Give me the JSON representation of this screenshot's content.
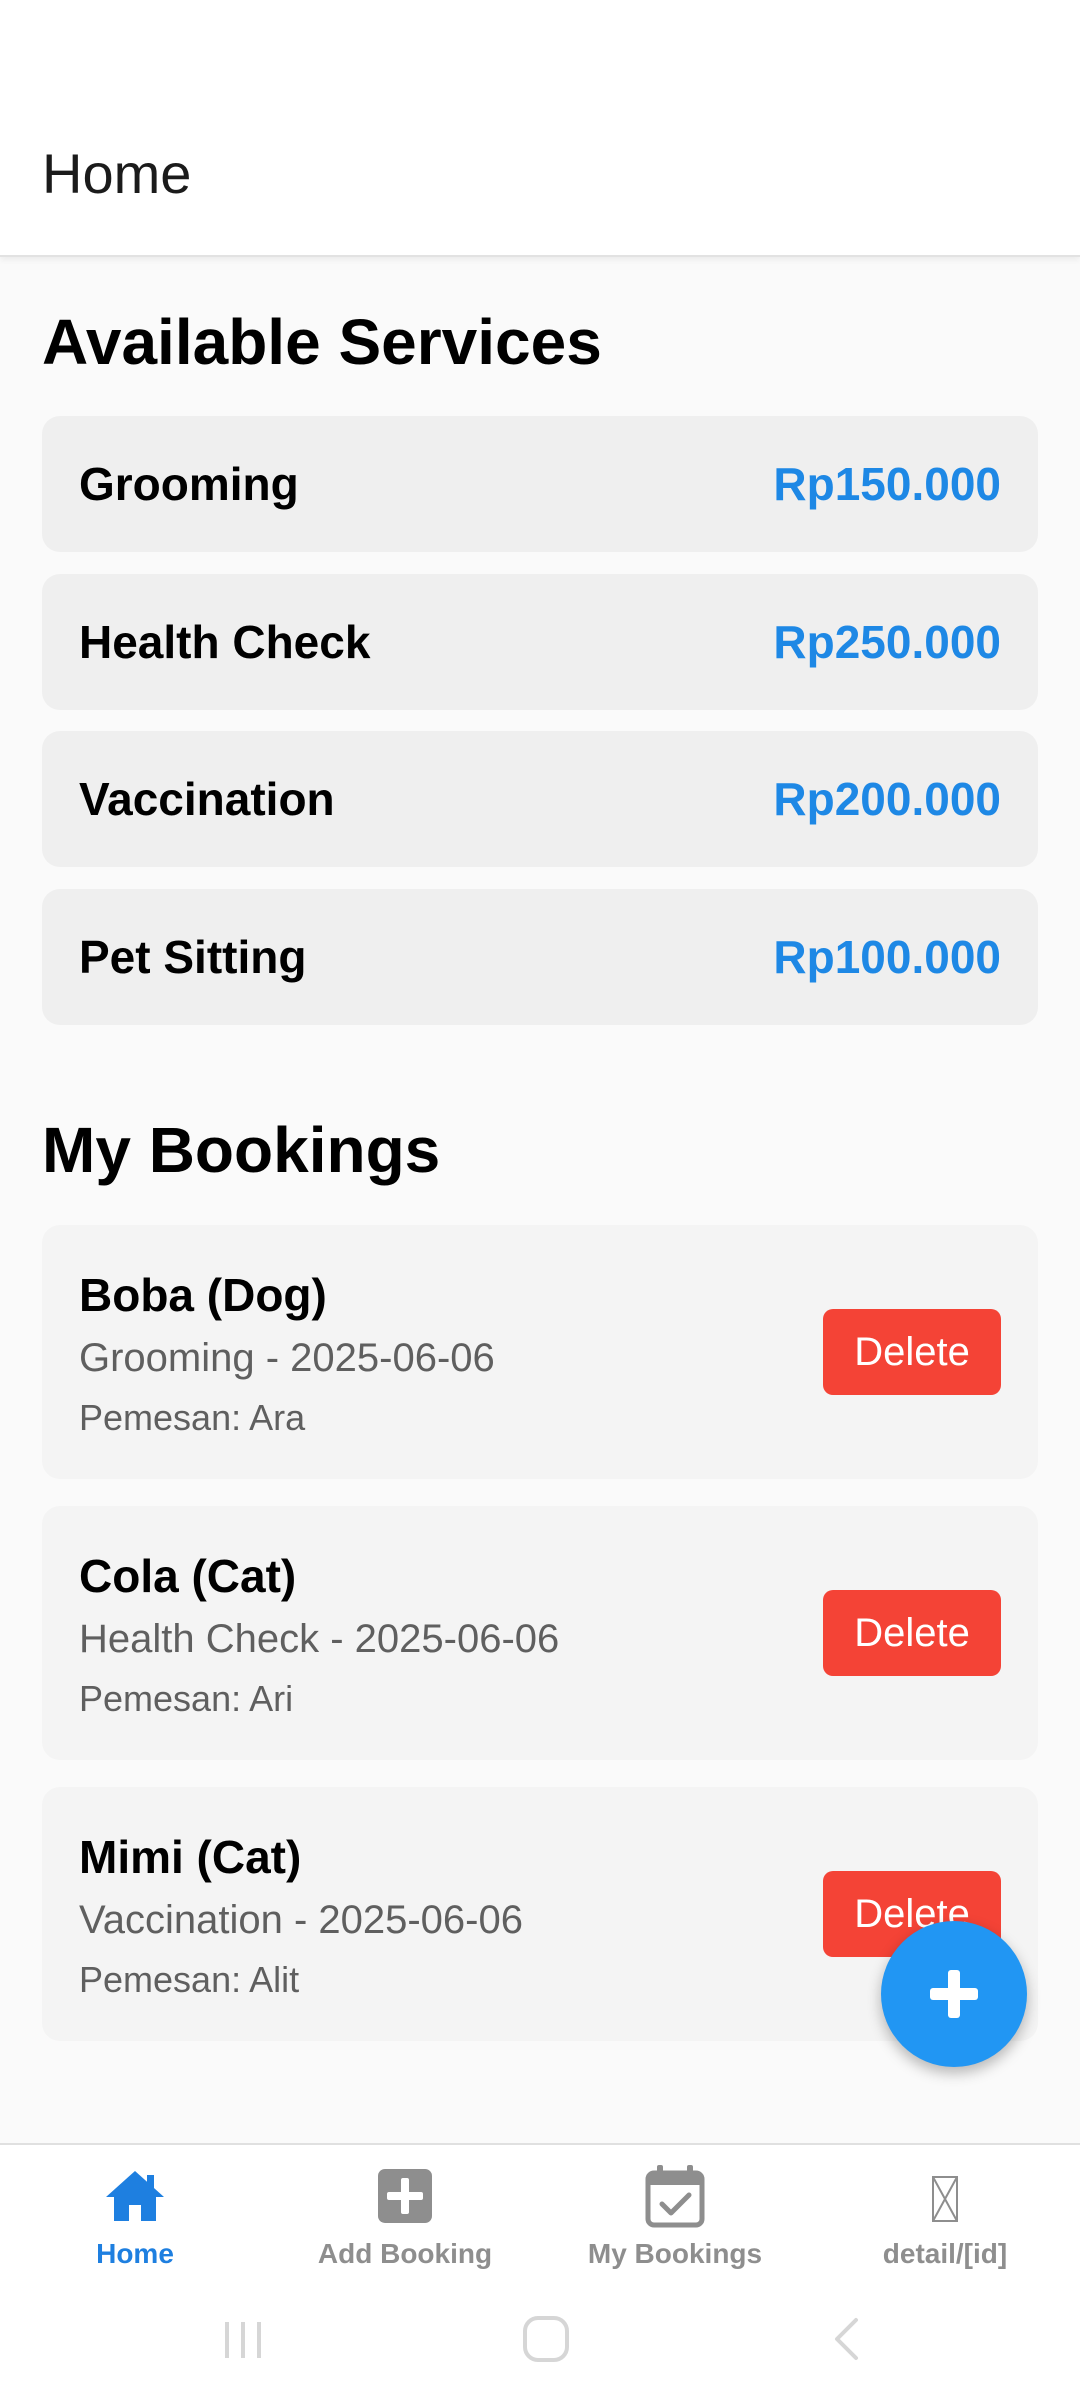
{
  "header": {
    "title": "Home"
  },
  "services_section": {
    "title": "Available Services",
    "items": [
      {
        "name": "Grooming",
        "price": "Rp150.000"
      },
      {
        "name": "Health Check",
        "price": "Rp250.000"
      },
      {
        "name": "Vaccination",
        "price": "Rp200.000"
      },
      {
        "name": "Pet Sitting",
        "price": "Rp100.000"
      }
    ]
  },
  "bookings_section": {
    "title": "My Bookings",
    "items": [
      {
        "pet": "Boba (Dog)",
        "service": "Grooming - 2025-06-06",
        "customer": "Pemesan: Ara",
        "action": "Delete"
      },
      {
        "pet": "Cola (Cat)",
        "service": "Health Check - 2025-06-06",
        "customer": "Pemesan: Ari",
        "action": "Delete"
      },
      {
        "pet": "Mimi (Cat)",
        "service": "Vaccination - 2025-06-06",
        "customer": "Pemesan: Alit",
        "action": "Delete"
      }
    ]
  },
  "fab": {
    "icon": "plus-icon"
  },
  "bottom_nav": {
    "items": [
      {
        "label": "Home",
        "icon": "home-icon",
        "active": true
      },
      {
        "label": "Add Booking",
        "icon": "plus-square-icon",
        "active": false
      },
      {
        "label": "My Bookings",
        "icon": "calendar-check-icon",
        "active": false
      },
      {
        "label": "detail/[id]",
        "icon": "missing-glyph-icon",
        "active": false
      }
    ]
  },
  "colors": {
    "accent": "#1e88e5",
    "fab": "#2196f3",
    "delete": "#f44336",
    "nav_active": "#1e7fe0",
    "nav_inactive": "#8e8e8e"
  }
}
